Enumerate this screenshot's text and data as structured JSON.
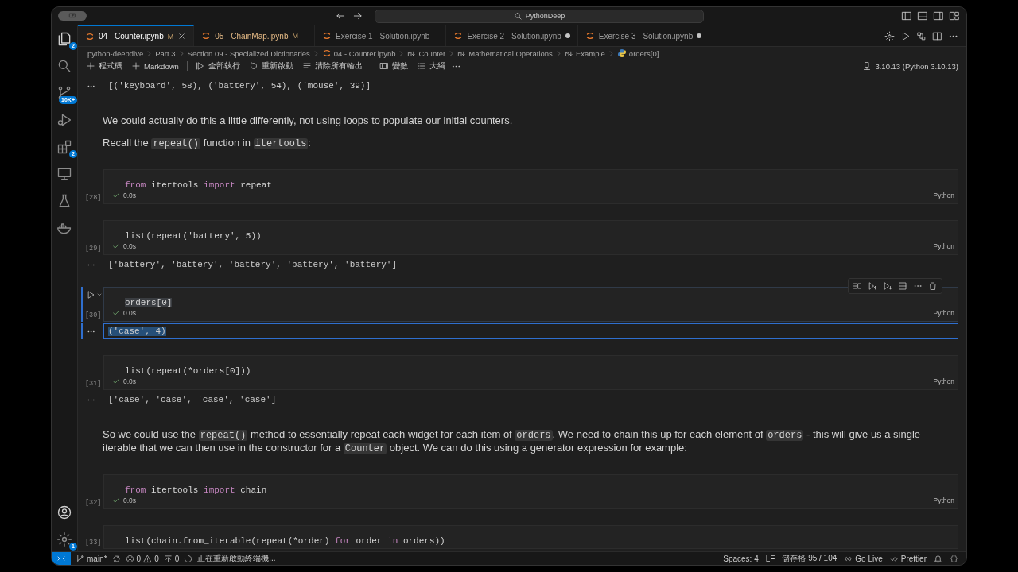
{
  "title_bar": {
    "search": "PythonDeep"
  },
  "activity_bar": {
    "top": [
      {
        "kind": "files",
        "badge": "2"
      },
      {
        "kind": "search"
      },
      {
        "kind": "scm",
        "badge": "10K+"
      },
      {
        "kind": "debug"
      },
      {
        "kind": "extensions",
        "badge": "2"
      },
      {
        "kind": "remote"
      },
      {
        "kind": "testing"
      },
      {
        "kind": "docker"
      }
    ],
    "bottom": [
      {
        "kind": "account"
      },
      {
        "kind": "settings",
        "badge": "1"
      }
    ]
  },
  "tabs": [
    {
      "label": "04 - Counter.ipynb",
      "git": "M",
      "dirty": false,
      "selected": true
    },
    {
      "label": "05 - ChainMap.ipynb",
      "git": "M",
      "dirty": false,
      "selected": false
    },
    {
      "label": "Exercise 1 - Solution.ipynb",
      "dirty": false,
      "selected": false
    },
    {
      "label": "Exercise 2 - Solution.ipynb",
      "dirty": true,
      "selected": false
    },
    {
      "label": "Exercise 3 - Solution.ipynb",
      "dirty": true,
      "selected": false
    }
  ],
  "breadcrumbs": [
    {
      "kind": "folder",
      "label": "python-deepdive"
    },
    {
      "kind": "folder",
      "label": "Part 3"
    },
    {
      "kind": "folder",
      "label": "Section 09 - Specialized Dictionaries"
    },
    {
      "kind": "notebook",
      "label": "04 - Counter.ipynb"
    },
    {
      "kind": "markdown",
      "label": "Counter"
    },
    {
      "kind": "markdown",
      "label": "Mathematical Operations"
    },
    {
      "kind": "markdown",
      "label": "Example"
    },
    {
      "kind": "python",
      "label": "orders[0]"
    }
  ],
  "toolbar": [
    {
      "kind": "add",
      "label": "程式碼"
    },
    {
      "kind": "add",
      "label": "Markdown"
    },
    {
      "kind": "separator"
    },
    {
      "kind": "run-all",
      "label": "全部執行"
    },
    {
      "kind": "restart",
      "label": "重新啟動"
    },
    {
      "kind": "clear",
      "label": "清除所有輸出"
    },
    {
      "kind": "separator"
    },
    {
      "kind": "variables",
      "label": "變數"
    },
    {
      "kind": "outline",
      "label": "大綱"
    },
    {
      "kind": "more"
    }
  ],
  "kernel": "3.10.13 (Python 3.10.13)",
  "cells": [
    {
      "kind": "output",
      "text": "[('keyboard', 58), ('battery', 54), ('mouse', 39)]",
      "selected": false
    },
    {
      "kind": "markdown",
      "paragraphs": [
        [
          {
            "kind": "text",
            "text": "We could actually do this a little differently, not using loops to populate our initial counters."
          }
        ],
        [
          {
            "kind": "text",
            "text": "Recall the "
          },
          {
            "kind": "code",
            "text": "repeat()"
          },
          {
            "kind": "text",
            "text": " function in "
          },
          {
            "kind": "code",
            "text": "itertools"
          },
          {
            "kind": "text",
            "text": ":"
          }
        ]
      ]
    },
    {
      "kind": "code",
      "count": "[28]",
      "time": "0.0s",
      "lang": "Python",
      "selected": false,
      "code": [
        {
          "kind": "kw",
          "text": "from"
        },
        {
          "kind": "plain",
          "text": " itertools "
        },
        {
          "kind": "kw",
          "text": "import"
        },
        {
          "kind": "plain",
          "text": " repeat"
        }
      ]
    },
    {
      "kind": "code",
      "count": "[29]",
      "time": "0.0s",
      "lang": "Python",
      "selected": false,
      "code": [
        {
          "kind": "plain",
          "text": "list(repeat('battery', 5))"
        }
      ]
    },
    {
      "kind": "output",
      "text": "['battery', 'battery', 'battery', 'battery', 'battery']",
      "selected": false
    },
    {
      "kind": "code",
      "count": "[30]",
      "time": "0.0s",
      "lang": "Python",
      "selected": true,
      "code": [
        {
          "kind": "match",
          "text": "orders[0]"
        }
      ]
    },
    {
      "kind": "output",
      "text": "('case', 4)",
      "selected": true
    },
    {
      "kind": "code",
      "count": "[31]",
      "time": "0.0s",
      "lang": "Python",
      "selected": false,
      "code": [
        {
          "kind": "plain",
          "text": "list(repeat(*orders[0]))"
        }
      ]
    },
    {
      "kind": "output",
      "text": "['case', 'case', 'case', 'case']",
      "selected": false
    },
    {
      "kind": "markdown",
      "paragraphs": [
        [
          {
            "kind": "text",
            "text": "So we could use the "
          },
          {
            "kind": "code",
            "text": "repeat()"
          },
          {
            "kind": "text",
            "text": " method to essentially repeat each widget for each item of "
          },
          {
            "kind": "code",
            "text": "orders"
          },
          {
            "kind": "text",
            "text": ". We need to chain this up for each element of "
          },
          {
            "kind": "code",
            "text": "orders"
          },
          {
            "kind": "text",
            "text": " - this will give us a single iterable that we can then use in the constructor for a "
          },
          {
            "kind": "code",
            "text": "Counter"
          },
          {
            "kind": "text",
            "text": " object. We can do this using a generator expression for example:"
          }
        ]
      ]
    },
    {
      "kind": "code",
      "count": "[32]",
      "time": "0.0s",
      "lang": "Python",
      "selected": false,
      "code": [
        {
          "kind": "kw",
          "text": "from"
        },
        {
          "kind": "plain",
          "text": " itertools "
        },
        {
          "kind": "kw",
          "text": "import"
        },
        {
          "kind": "plain",
          "text": " chain"
        }
      ]
    },
    {
      "kind": "code",
      "count": "[33]",
      "selected": false,
      "code": [
        {
          "kind": "plain",
          "text": "list(chain.from_iterable(repeat(*order) "
        },
        {
          "kind": "kw",
          "text": "for"
        },
        {
          "kind": "plain",
          "text": " order "
        },
        {
          "kind": "kw",
          "text": "in"
        },
        {
          "kind": "plain",
          "text": " orders))"
        }
      ]
    }
  ],
  "status_bar": {
    "branch": "main*",
    "errors": "0",
    "warnings": "0",
    "ports": "0",
    "message": "正在重新啟動終端機...",
    "right": [
      {
        "kind": "text",
        "label": "Spaces: 4"
      },
      {
        "kind": "text",
        "label": "LF"
      },
      {
        "kind": "text",
        "label": "儲存格 95 / 104"
      },
      {
        "kind": "golive",
        "label": "Go Live"
      },
      {
        "kind": "prettier",
        "label": "Prettier"
      },
      {
        "kind": "bell"
      },
      {
        "kind": "braces"
      }
    ]
  }
}
